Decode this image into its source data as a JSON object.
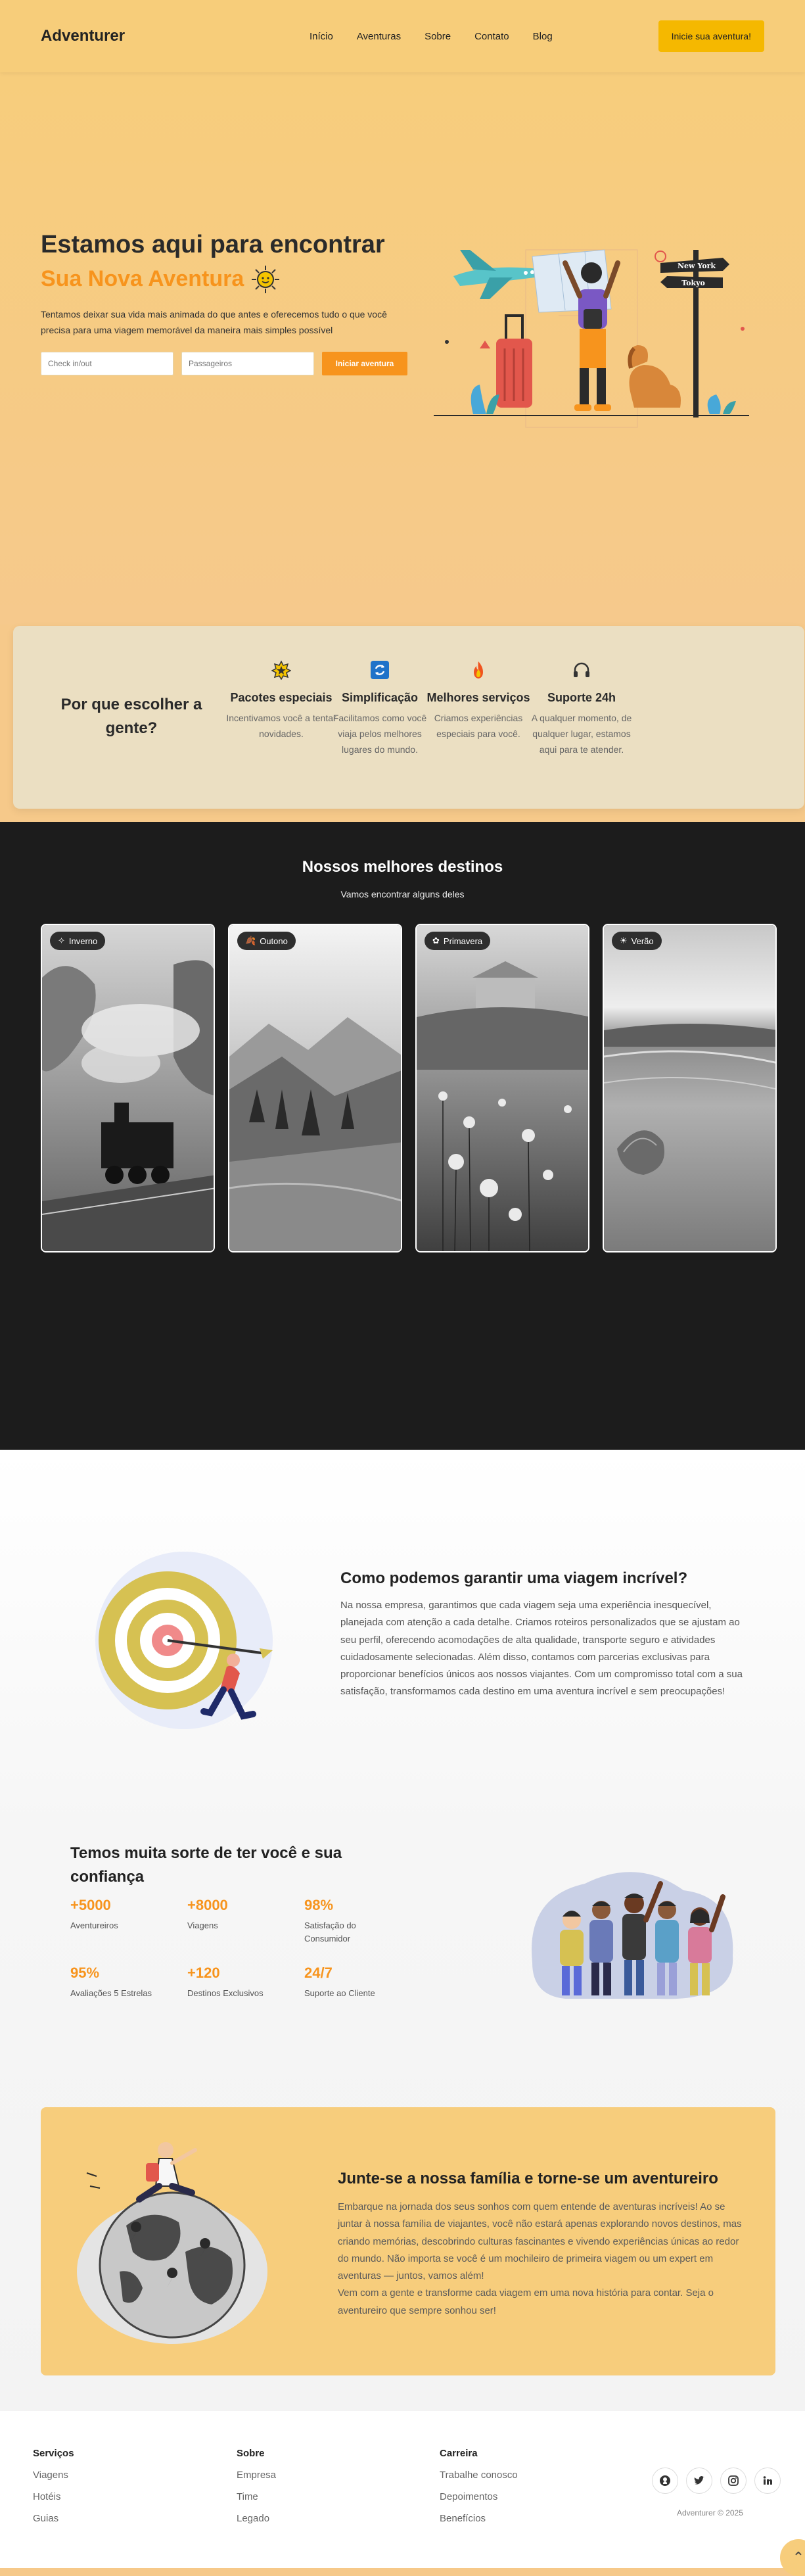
{
  "header": {
    "logo": "Adventurer",
    "nav": [
      "Início",
      "Aventuras",
      "Sobre",
      "Contato",
      "Blog"
    ],
    "cta": "Inicie sua aventura!"
  },
  "hero": {
    "title": "Estamos aqui para encontrar",
    "subtitle": "Sua Nova Aventura",
    "description": "Tentamos deixar sua vida mais animada do que antes e oferecemos tudo o que você precisa para uma viagem memorável da maneira mais simples possível",
    "checkin_placeholder": "Check in/out",
    "passengers_placeholder": "Passageiros",
    "button": "Iniciar aventura",
    "signs": [
      "New York",
      "Tokyo"
    ]
  },
  "why": {
    "title": "Por que escolher a gente?",
    "items": [
      {
        "icon": "badge-star-icon",
        "title": "Pacotes especiais",
        "desc": "Incentivamos você a tentar novidades."
      },
      {
        "icon": "sync-icon",
        "title": "Simplificação",
        "desc": "Facilitamos como você viaja pelos melhores lugares do mundo."
      },
      {
        "icon": "fire-icon",
        "title": "Melhores serviços",
        "desc": "Criamos experiências especiais para você."
      },
      {
        "icon": "headphones-icon",
        "title": "Suporte 24h",
        "desc": "A qualquer momento, de qualquer lugar, estamos aqui para te atender."
      }
    ]
  },
  "destinations": {
    "title": "Nossos melhores destinos",
    "subtitle": "Vamos encontrar alguns deles",
    "cards": [
      {
        "label": "Inverno",
        "icon": "snowflake-icon"
      },
      {
        "label": "Outono",
        "icon": "leaf-icon"
      },
      {
        "label": "Primavera",
        "icon": "flower-icon"
      },
      {
        "label": "Verão",
        "icon": "sun-icon"
      }
    ]
  },
  "guarantee": {
    "title": "Como podemos garantir uma viagem incrível?",
    "description": "Na nossa empresa, garantimos que cada viagem seja uma experiência inesquecível, planejada com atenção a cada detalhe. Criamos roteiros personalizados que se ajustam ao seu perfil, oferecendo acomodações de alta qualidade, transporte seguro e atividades cuidadosamente selecionadas. Além disso, contamos com parcerias exclusivas para proporcionar benefícios únicos aos nossos viajantes. Com um compromisso total com a sua satisfação, transformamos cada destino em uma aventura incrível e sem preocupações!"
  },
  "stats": {
    "title": "Temos muita sorte de ter você e sua confiança",
    "items": [
      {
        "value": "+5000",
        "label": "Aventureiros"
      },
      {
        "value": "+8000",
        "label": "Viagens"
      },
      {
        "value": "98%",
        "label": "Satisfação do Consumidor"
      },
      {
        "value": "95%",
        "label": "Avaliações 5 Estrelas"
      },
      {
        "value": "+120",
        "label": "Destinos Exclusivos"
      },
      {
        "value": "24/7",
        "label": "Suporte ao Cliente"
      }
    ]
  },
  "join": {
    "title": "Junte-se a nossa família e torne-se um aventureiro",
    "description": "Embarque na jornada dos seus sonhos com quem entende de aventuras incríveis! Ao se juntar à nossa família de viajantes, você não estará apenas explorando novos destinos, mas criando memórias, descobrindo culturas fascinantes e vivendo experiências únicas ao redor do mundo. Não importa se você é um mochileiro de primeira viagem ou um expert em aventuras — juntos, vamos além!",
    "description2": "Vem com a gente e transforme cada viagem em uma nova história para contar. Seja o aventureiro que sempre sonhou ser!"
  },
  "footer": {
    "columns": [
      {
        "title": "Serviços",
        "links": [
          "Viagens",
          "Hotéis",
          "Guias"
        ]
      },
      {
        "title": "Sobre",
        "links": [
          "Empresa",
          "Time",
          "Legado"
        ]
      },
      {
        "title": "Carreira",
        "links": [
          "Trabalhe conosco",
          "Depoimentos",
          "Benefícios"
        ]
      }
    ],
    "socials": [
      "github-icon",
      "twitter-icon",
      "instagram-icon",
      "linkedin-icon"
    ],
    "copyright": "Adventurer © 2025"
  },
  "colors": {
    "accent": "#f7941d",
    "header_bg": "#f7cd7a",
    "cta_bg": "#f5b800",
    "dark_bg": "#1c1c1c"
  }
}
